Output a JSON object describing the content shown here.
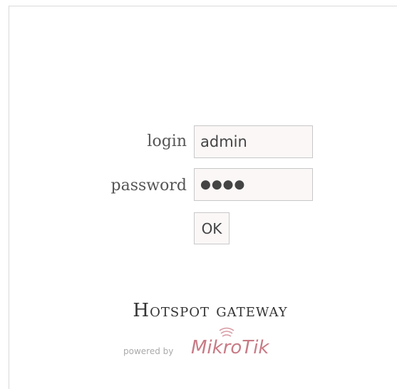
{
  "login": {
    "label": "login",
    "value": "admin"
  },
  "password": {
    "label": "password",
    "value": "●●●●"
  },
  "submit": {
    "label": "OK"
  },
  "footer": {
    "title": "Hotspot gateway",
    "powered_by": "powered by",
    "brand": "MikroTik",
    "brand_color": "#c87b86"
  }
}
